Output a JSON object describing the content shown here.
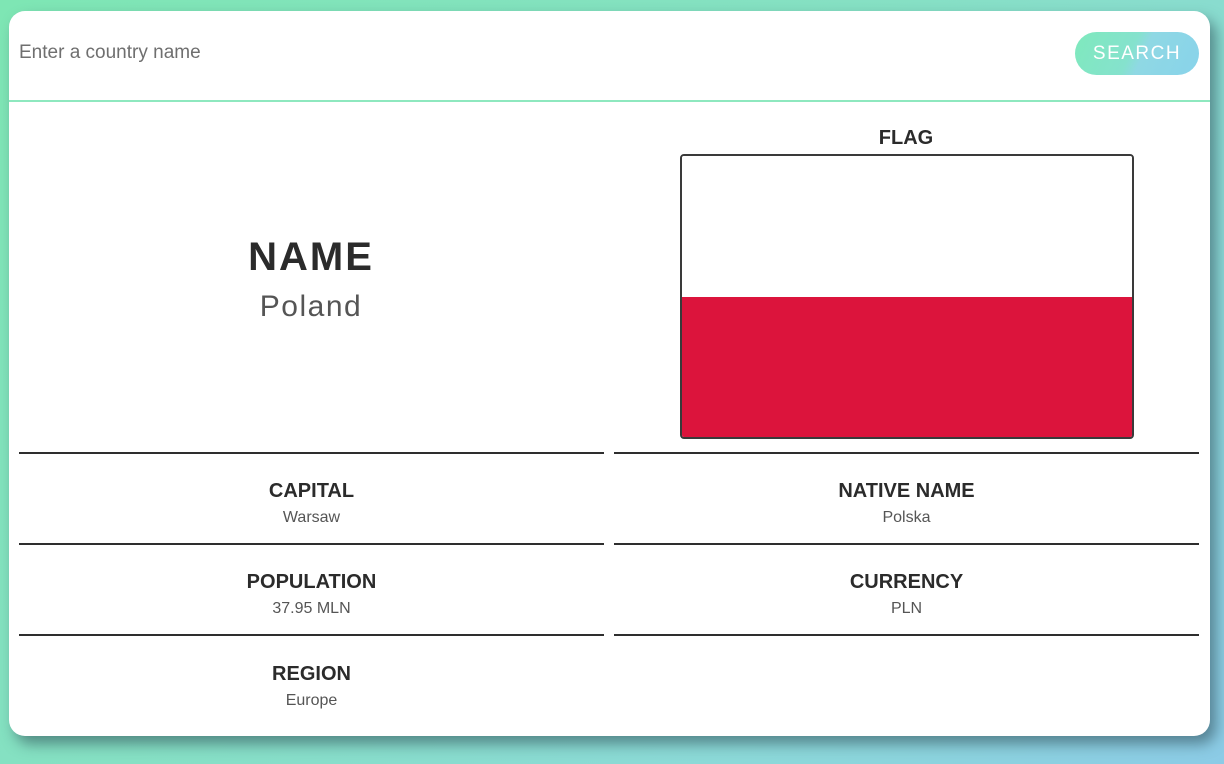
{
  "search": {
    "placeholder": "Enter a country name",
    "value": "",
    "button_label": "SEARCH"
  },
  "country": {
    "name_label": "NAME",
    "name_value": "Poland",
    "flag_label": "FLAG",
    "flag_colors": [
      "#ffffff",
      "#dc143c"
    ],
    "fields": {
      "capital": {
        "label": "CAPITAL",
        "value": "Warsaw"
      },
      "native_name": {
        "label": "NATIVE NAME",
        "value": "Polska"
      },
      "population": {
        "label": "POPULATION",
        "value": "37.95 MLN"
      },
      "currency": {
        "label": "CURRENCY",
        "value": "PLN"
      },
      "region": {
        "label": "REGION",
        "value": "Europe"
      }
    }
  },
  "colors": {
    "accent_green": "#7fe9bd",
    "accent_blue": "#88d3ea",
    "text_dark": "#2b2b2b"
  }
}
